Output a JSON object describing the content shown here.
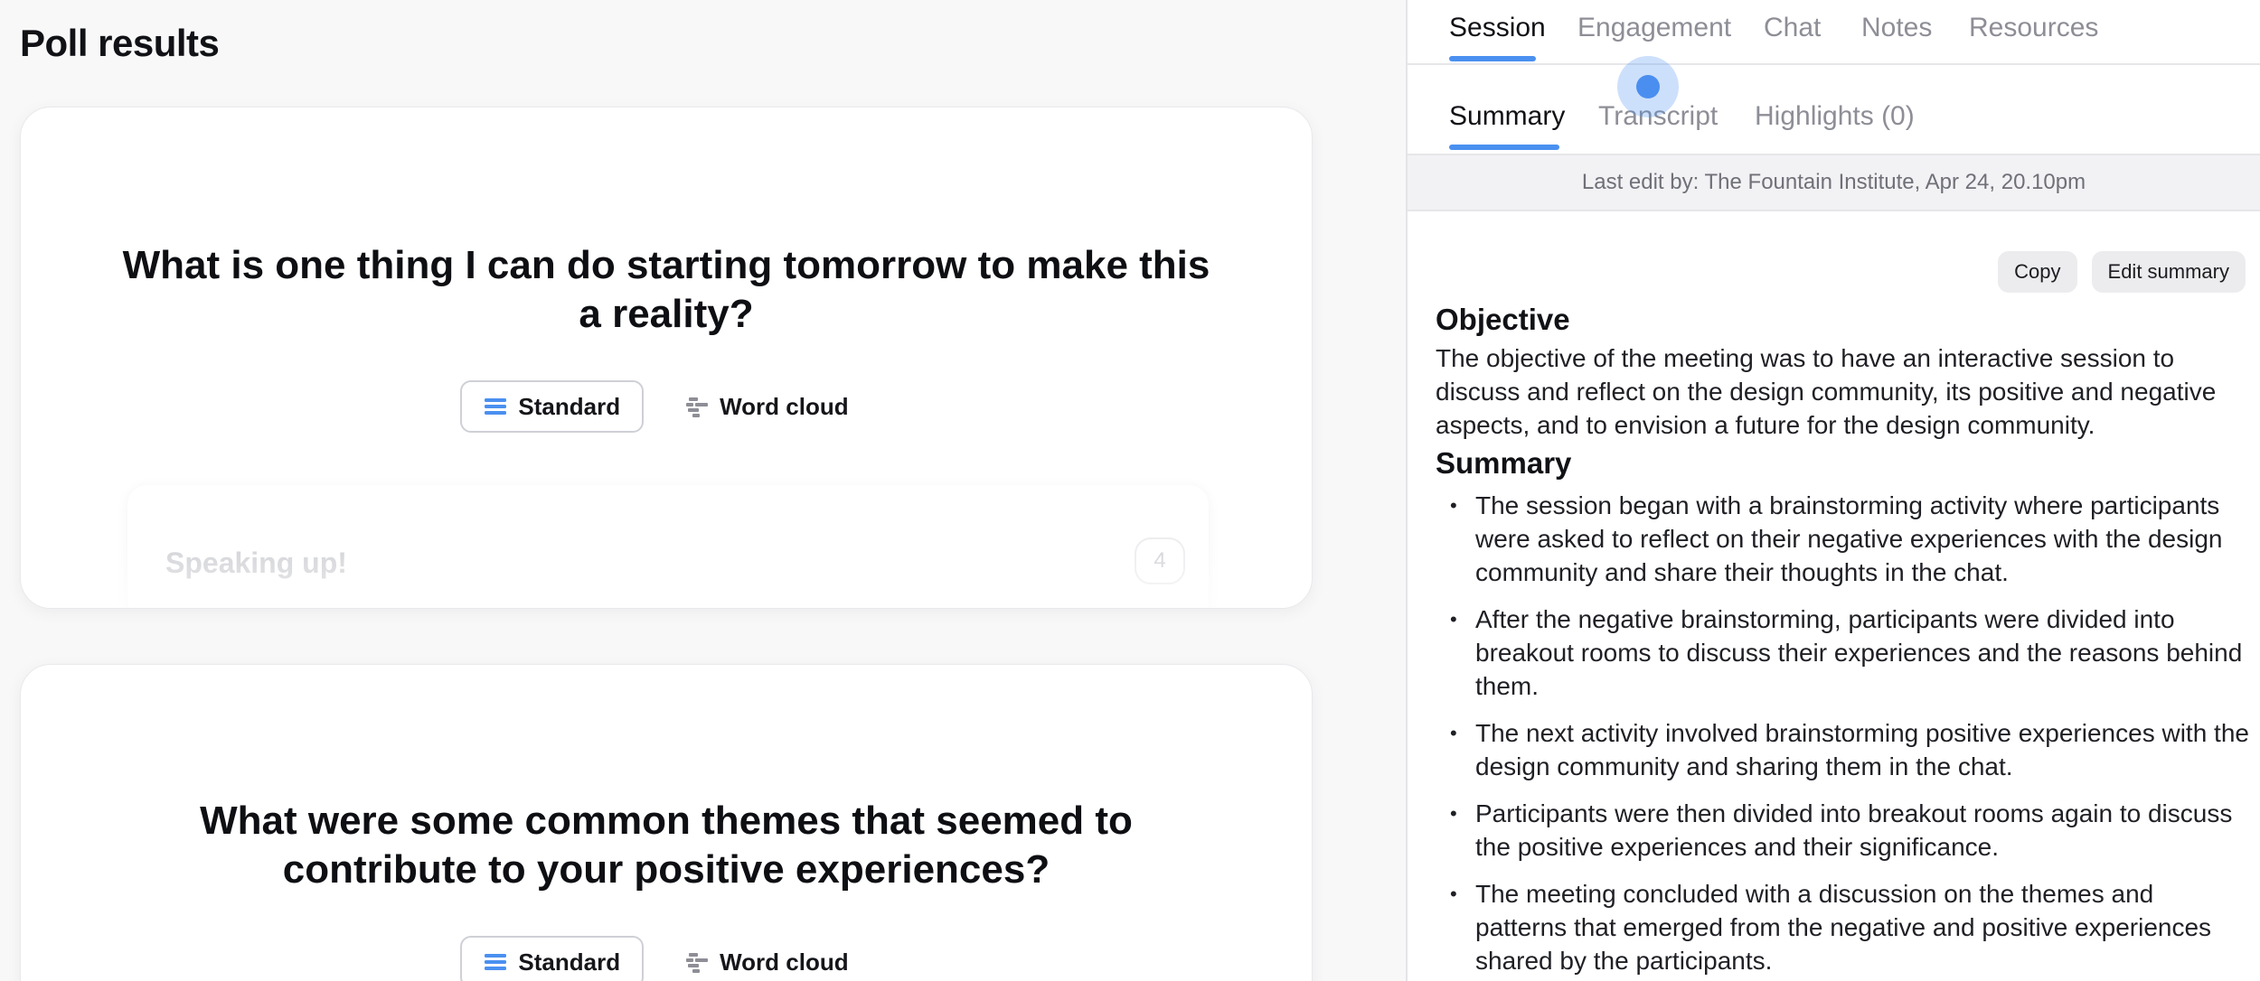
{
  "page": {
    "title": "Poll results"
  },
  "polls": [
    {
      "question": "What is one thing I can do starting tomorrow to make this a reality?",
      "view_standard": "Standard",
      "view_wordcloud": "Word cloud",
      "response": {
        "text": "Speaking up!",
        "count": "4"
      }
    },
    {
      "question": "What were some common themes that seemed to contribute to your positive experiences?",
      "view_standard": "Standard",
      "view_wordcloud": "Word cloud"
    }
  ],
  "tabs": [
    "Session",
    "Engagement",
    "Chat",
    "Notes",
    "Resources"
  ],
  "active_tab": "Session",
  "sub_tabs": [
    "Summary",
    "Transcript",
    "Highlights (0)"
  ],
  "active_sub_tab": "Summary",
  "last_edit": "Last edit by: The Fountain Institute, Apr 24, 20.10pm",
  "actions": {
    "copy": "Copy",
    "edit_summary": "Edit summary"
  },
  "summary": {
    "objective_heading": "Objective",
    "objective_text": "The objective of the meeting was to have an interactive session to discuss and reflect on the design community, its positive and negative aspects, and to envision a future for the design community.",
    "summary_heading": "Summary",
    "bullets": [
      "The session began with a brainstorming activity where participants were asked to reflect on their negative experiences with the design community and share their thoughts in the chat.",
      "After the negative brainstorming, participants were divided into breakout rooms to discuss their experiences and the reasons behind them.",
      "The next activity involved brainstorming positive experiences with the design community and sharing them in the chat.",
      "Participants were then divided into breakout rooms again to discuss the positive experiences and their significance.",
      "The meeting concluded with a discussion on the themes and patterns that emerged from the negative and positive experiences shared by the participants."
    ]
  },
  "colors": {
    "accent": "#4a90f0",
    "muted_text": "#8d8e96"
  }
}
